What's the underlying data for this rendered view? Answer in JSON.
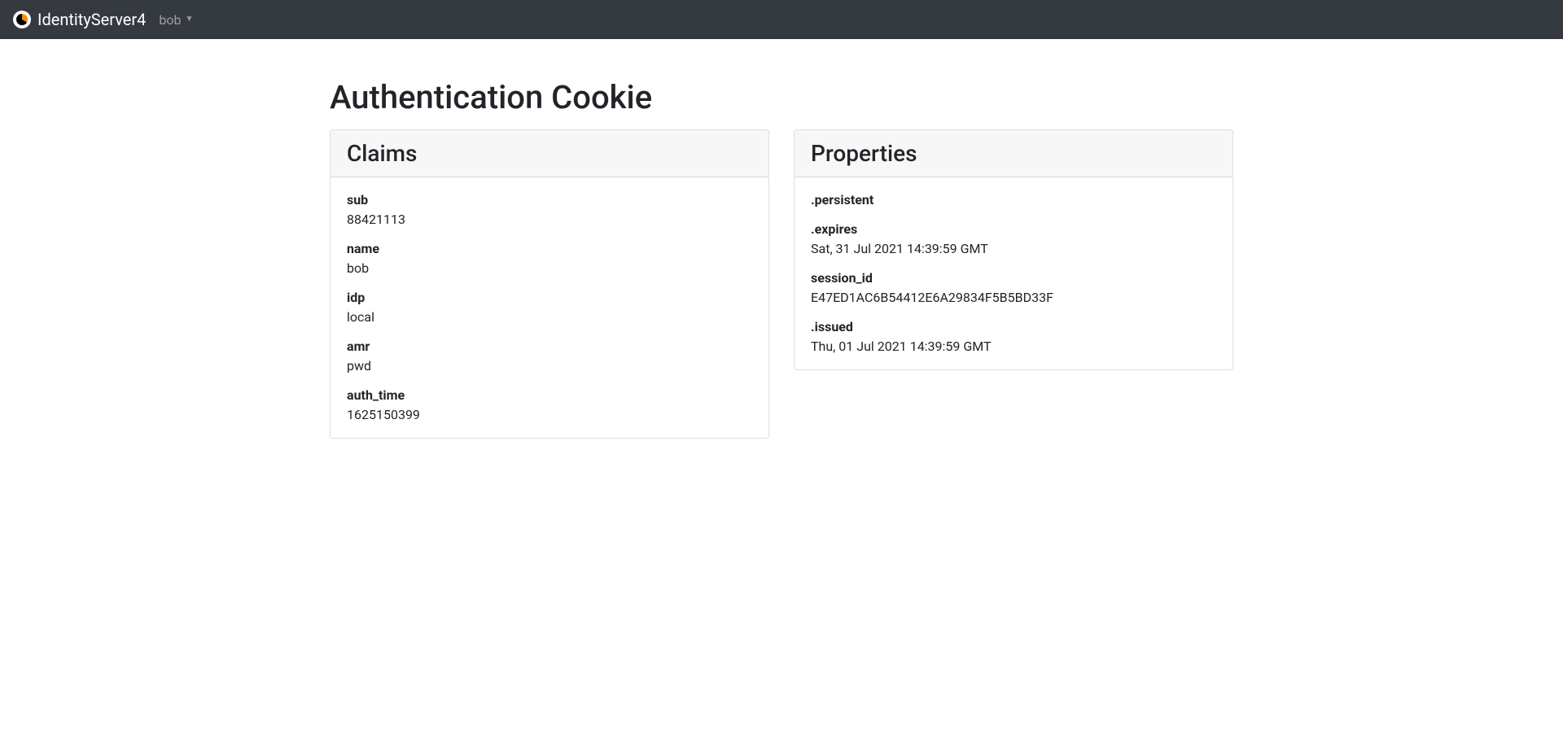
{
  "navbar": {
    "brand": "IdentityServer4",
    "user": "bob"
  },
  "page": {
    "title": "Authentication Cookie"
  },
  "claims": {
    "heading": "Claims",
    "items": [
      {
        "key": "sub",
        "value": "88421113"
      },
      {
        "key": "name",
        "value": "bob"
      },
      {
        "key": "idp",
        "value": "local"
      },
      {
        "key": "amr",
        "value": "pwd"
      },
      {
        "key": "auth_time",
        "value": "1625150399"
      }
    ]
  },
  "properties": {
    "heading": "Properties",
    "items": [
      {
        "key": ".persistent",
        "value": ""
      },
      {
        "key": ".expires",
        "value": "Sat, 31 Jul 2021 14:39:59 GMT"
      },
      {
        "key": "session_id",
        "value": "E47ED1AC6B54412E6A29834F5B5BD33F"
      },
      {
        "key": ".issued",
        "value": "Thu, 01 Jul 2021 14:39:59 GMT"
      }
    ]
  }
}
